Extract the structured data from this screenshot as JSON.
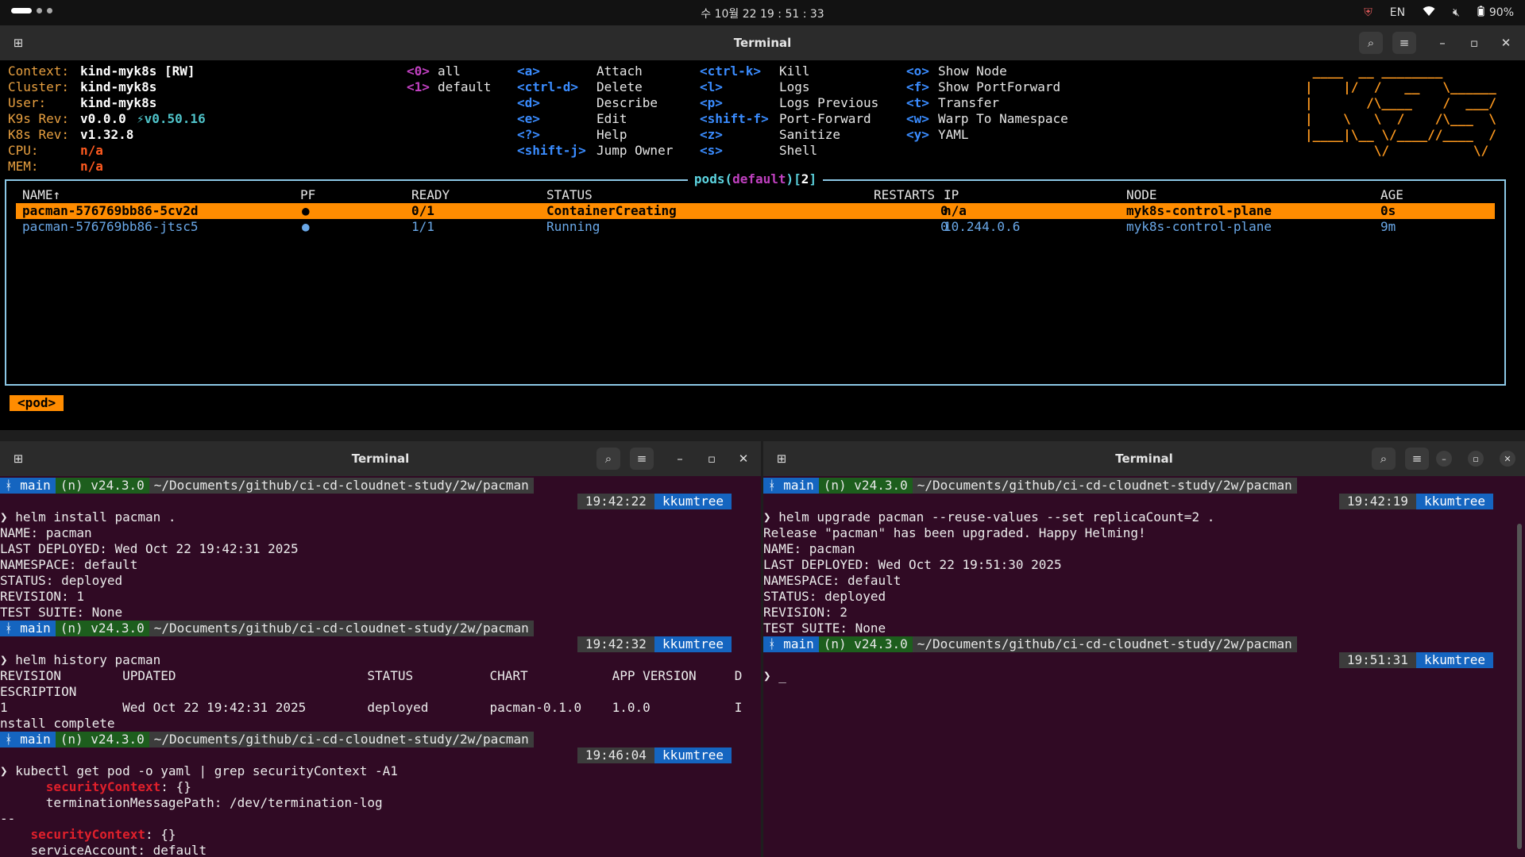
{
  "top_bar": {
    "clock": "수 10월 22  19 : 51 : 33",
    "lang": "EN",
    "battery": "90%",
    "icons": [
      "shield-icon",
      "wifi-icon",
      "volume-muted-icon",
      "battery-icon"
    ]
  },
  "k9s_window": {
    "title": "Terminal",
    "info": [
      {
        "label": "Context:",
        "value": "kind-myk8s [RW]"
      },
      {
        "label": "Cluster:",
        "value": "kind-myk8s"
      },
      {
        "label": "User:",
        "value": "kind-myk8s"
      },
      {
        "label": "K9s Rev:",
        "value": "v0.0.0",
        "extra": "⚡v0.50.16"
      },
      {
        "label": "K8s Rev:",
        "value": "v1.32.8"
      },
      {
        "label": "CPU:",
        "value": "n/a"
      },
      {
        "label": "MEM:",
        "value": "n/a"
      }
    ],
    "namespaces": [
      {
        "key": "<0>",
        "label": "all"
      },
      {
        "key": "<1>",
        "label": "default"
      }
    ],
    "hotkeys_col1": [
      {
        "key": "<a>",
        "label": "Attach"
      },
      {
        "key": "<ctrl-d>",
        "label": "Delete"
      },
      {
        "key": "<d>",
        "label": "Describe"
      },
      {
        "key": "<e>",
        "label": "Edit"
      },
      {
        "key": "<?>",
        "label": "Help"
      },
      {
        "key": "<shift-j>",
        "label": "Jump Owner"
      }
    ],
    "hotkeys_col2": [
      {
        "key": "<ctrl-k>",
        "label": "Kill"
      },
      {
        "key": "<l>",
        "label": "Logs"
      },
      {
        "key": "<p>",
        "label": "Logs Previous"
      },
      {
        "key": "<shift-f>",
        "label": "Port-Forward"
      },
      {
        "key": "<z>",
        "label": "Sanitize"
      },
      {
        "key": "<s>",
        "label": "Shell"
      }
    ],
    "hotkeys_col3": [
      {
        "key": "<o>",
        "label": "Show Node"
      },
      {
        "key": "<f>",
        "label": "Show PortForward"
      },
      {
        "key": "<t>",
        "label": "Transfer"
      },
      {
        "key": "<w>",
        "label": "Warp To Namespace"
      },
      {
        "key": "<y>",
        "label": "YAML"
      }
    ],
    "logo_lines": [
      " ____  __ ________        ",
      "|    |/  /   __   \\______ ",
      "|       /\\____    /  ___/ ",
      "|    \\   \\  /    /\\___  \\ ",
      "|____|\\__ \\/____//____  / ",
      "         \\/           \\/  "
    ],
    "table": {
      "title_prefix": "pods(",
      "title_ns": "default",
      "title_mid": ")[",
      "title_count": "2",
      "title_suffix": "]",
      "columns": [
        "NAME↑",
        "PF",
        "READY",
        "STATUS",
        "RESTARTS",
        "IP",
        "NODE",
        "AGE"
      ],
      "rows": [
        {
          "name": "pacman-576769bb86-5cv2d",
          "pf": "●",
          "ready": "0/1",
          "status": "ContainerCreating",
          "restarts": "0",
          "ip": "n/a",
          "node": "myk8s-control-plane",
          "age": "0s"
        },
        {
          "name": "pacman-576769bb86-jtsc5",
          "pf": "●",
          "ready": "1/1",
          "status": "Running",
          "restarts": "0",
          "ip": "10.244.0.6",
          "node": "myk8s-control-plane",
          "age": "9m"
        }
      ]
    },
    "crumb": "<pod>"
  },
  "left_terminal": {
    "title": "Terminal",
    "prompt": {
      "branch": "main",
      "node": "(n) v24.3.0",
      "path": "~/Documents/github/ci-cd-cloudnet-study/2w/pacman",
      "user": "kkumtree"
    },
    "times": [
      "19:42:22",
      "19:42:32",
      "19:46:04"
    ],
    "block1": [
      "❯ helm install pacman .",
      "NAME: pacman",
      "LAST DEPLOYED: Wed Oct 22 19:42:31 2025",
      "NAMESPACE: default",
      "STATUS: deployed",
      "REVISION: 1",
      "TEST SUITE: None"
    ],
    "block2": [
      "❯ helm history pacman",
      "REVISION        UPDATED                         STATUS          CHART           APP VERSION     D",
      "ESCRIPTION",
      "1               Wed Oct 22 19:42:31 2025        deployed        pacman-0.1.0    1.0.0           I",
      "nstall complete"
    ],
    "block3_cmd": "❯ kubectl get pod -o yaml | grep securityContext -A1",
    "sc_keyword": "securityContext",
    "sc_suffix": ": {}",
    "term_path": "      terminationMessagePath: /dev/termination-log",
    "sep": "--",
    "service_account": "    serviceAccount: default"
  },
  "right_terminal": {
    "title": "Terminal",
    "prompt": {
      "branch": "main",
      "node": "(n) v24.3.0",
      "path": "~/Documents/github/ci-cd-cloudnet-study/2w/pacman",
      "user": "kkumtree"
    },
    "times": [
      "19:42:19",
      "19:51:31"
    ],
    "block1": [
      "❯ helm upgrade pacman --reuse-values --set replicaCount=2 .",
      "Release \"pacman\" has been upgraded. Happy Helming!",
      "NAME: pacman",
      "LAST DEPLOYED: Wed Oct 22 19:51:30 2025",
      "NAMESPACE: default",
      "STATUS: deployed",
      "REVISION: 2",
      "TEST SUITE: None"
    ],
    "cursor_line": "❯ _"
  }
}
